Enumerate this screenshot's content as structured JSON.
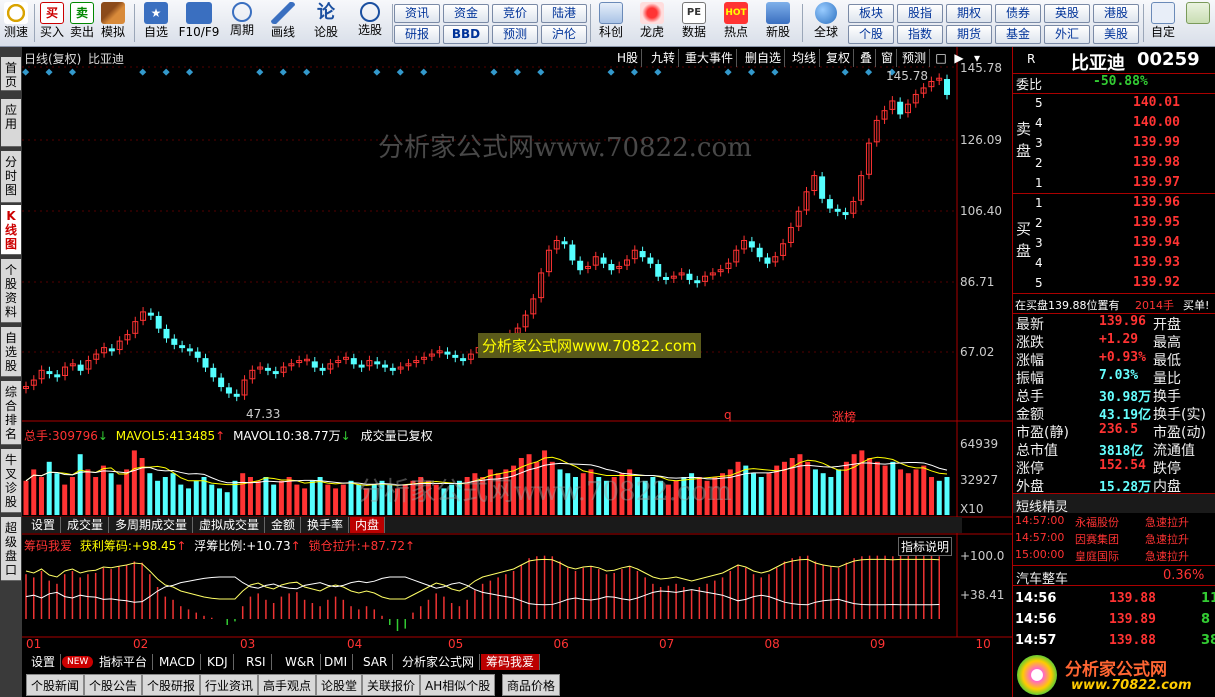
{
  "toolbar": {
    "buttons": [
      {
        "label": "测速",
        "icon": "clock-icon"
      },
      {
        "label": "买入",
        "icon": "buy-icon"
      },
      {
        "label": "卖出",
        "icon": "sell-icon"
      },
      {
        "label": "模拟",
        "icon": "hammer-icon"
      },
      {
        "label": "自选",
        "icon": "star-icon"
      },
      {
        "label": "F10/F9",
        "icon": "f10-icon"
      },
      {
        "label": "周期",
        "icon": "period-icon"
      },
      {
        "label": "画线",
        "icon": "pen-icon"
      },
      {
        "label": "论股",
        "icon": "forum-icon"
      },
      {
        "label": "选股",
        "icon": "select-stock-icon"
      },
      {
        "label": "科创",
        "icon": "kechuang-icon"
      },
      {
        "label": "龙虎",
        "icon": "dragon-tiger-icon"
      },
      {
        "label": "数据",
        "icon": "pe-icon"
      },
      {
        "label": "热点",
        "icon": "hot-icon"
      },
      {
        "label": "新股",
        "icon": "ipo-icon"
      },
      {
        "label": "全球",
        "icon": "globe-icon"
      },
      {
        "label": "自定",
        "icon": "custom-icon"
      }
    ],
    "pills": [
      "资讯",
      "资金",
      "竞价",
      "陆港",
      "研报",
      "BBD",
      "预测",
      "沪伦",
      "板块",
      "股指",
      "期权",
      "债券",
      "英股",
      "港股",
      "个股",
      "指数",
      "期货",
      "基金",
      "外汇",
      "美股"
    ],
    "f10_icon_text": "PE",
    "hot_icon_text": "HOT"
  },
  "left_tabs": [
    "首页",
    "应用",
    "分时图",
    "K线图",
    "个股资料",
    "自选股",
    "综合排名",
    "牛叉诊股",
    "超级盘口"
  ],
  "chart": {
    "title": "日线(复权)",
    "stock_name": "比亚迪",
    "top_menu": [
      "H股",
      "九转",
      "重大事件",
      "删自选",
      "均线",
      "复权",
      "叠",
      "窗",
      "预测"
    ],
    "price_axis": [
      "145.78",
      "126.09",
      "106.40",
      "86.71",
      "67.02"
    ],
    "high_label": "145.78",
    "low_label": "47.33",
    "q_mark": "q",
    "zhang_mark": "涨榜",
    "watermark1": "分析家公式网www.70822.com",
    "watermark2": "分析家公式网www.70822.com",
    "watermark3": "分析家公式网www.70822.com",
    "vol_header": {
      "label": "总手:",
      "val": "309796",
      "arrow": "↓",
      "ma5_label": "MAVOL5:",
      "ma5": "413485",
      "ma5_arrow": "↑",
      "ma10_label": "MAVOL10:",
      "ma10": "38.77万",
      "ma10_arrow": "↓",
      "note": "成交量已复权"
    },
    "vol_axis": [
      "64939",
      "32927",
      "X10"
    ],
    "mid_tabs": [
      "设置",
      "成交量",
      "多周期成交量",
      "虚拟成交量",
      "金额",
      "换手率",
      "内盘"
    ],
    "ind_header": {
      "name": "筹码我爱",
      "a_label": "获利筹码:",
      "a": "+98.45",
      "a_arrow": "↑",
      "b_label": "浮筹比例:",
      "b": "+10.73",
      "b_arrow": "↑",
      "c_label": "锁仓拉升:",
      "c": "+87.72",
      "c_arrow": "↑",
      "btn": "指标说明"
    },
    "ind_axis": [
      "+100.0",
      "+38.41"
    ],
    "months": [
      "01",
      "02",
      "03",
      "04",
      "05",
      "06",
      "07",
      "08",
      "09",
      "10"
    ],
    "candles": [
      50,
      52,
      55,
      54,
      53,
      56,
      57,
      55,
      58,
      60,
      62,
      61,
      64,
      66,
      70,
      73,
      72,
      68,
      65,
      63,
      62,
      61,
      59,
      56,
      53,
      50,
      48,
      47,
      52,
      55,
      56,
      55,
      54,
      56,
      57,
      58,
      58,
      56,
      55,
      57,
      58,
      59,
      57,
      56,
      58,
      57,
      56,
      55,
      56,
      57,
      58,
      59,
      60,
      61,
      60,
      59,
      58,
      60,
      62,
      63,
      64,
      65,
      66,
      68,
      72,
      77,
      85,
      92,
      95,
      94,
      89,
      86,
      87,
      90,
      88,
      86,
      87,
      89,
      92,
      90,
      88,
      84,
      83,
      84,
      85,
      83,
      82,
      84,
      85,
      86,
      88,
      92,
      95,
      93,
      90,
      88,
      90,
      94,
      99,
      104,
      110,
      115,
      108,
      105,
      104,
      103,
      107,
      115,
      125,
      132,
      135,
      138,
      134,
      137,
      140,
      142,
      144,
      145,
      140
    ],
    "vol_bars": [
      0.45,
      0.6,
      0.5,
      0.7,
      0.55,
      0.4,
      0.5,
      0.8,
      0.6,
      0.5,
      0.65,
      0.55,
      0.4,
      0.6,
      0.85,
      0.75,
      0.55,
      0.45,
      0.5,
      0.55,
      0.4,
      0.35,
      0.45,
      0.5,
      0.4,
      0.35,
      0.3,
      0.45,
      0.55,
      0.5,
      0.45,
      0.5,
      0.4,
      0.45,
      0.5,
      0.4,
      0.35,
      0.45,
      0.5,
      0.4,
      0.35,
      0.4,
      0.45,
      0.4,
      0.35,
      0.4,
      0.45,
      0.4,
      0.35,
      0.4,
      0.45,
      0.5,
      0.45,
      0.4,
      0.35,
      0.4,
      0.45,
      0.5,
      0.55,
      0.5,
      0.6,
      0.55,
      0.6,
      0.65,
      0.75,
      0.8,
      0.7,
      0.85,
      0.7,
      0.6,
      0.55,
      0.5,
      0.55,
      0.6,
      0.5,
      0.45,
      0.5,
      0.55,
      0.6,
      0.5,
      0.45,
      0.5,
      0.45,
      0.4,
      0.45,
      0.5,
      0.55,
      0.5,
      0.45,
      0.5,
      0.55,
      0.6,
      0.7,
      0.65,
      0.55,
      0.5,
      0.55,
      0.65,
      0.7,
      0.75,
      0.8,
      0.7,
      0.6,
      0.55,
      0.5,
      0.6,
      0.7,
      0.8,
      0.85,
      0.75,
      0.7,
      0.65,
      0.7,
      0.6,
      0.55,
      0.6,
      0.65,
      0.5,
      0.45,
      0.5
    ],
    "ind_bars": [
      0.7,
      0.65,
      0.75,
      0.6,
      0.55,
      0.7,
      0.75,
      0.65,
      0.7,
      0.72,
      0.8,
      0.78,
      0.82,
      0.85,
      0.9,
      0.88,
      0.7,
      0.5,
      0.35,
      0.3,
      0.2,
      0.15,
      0.1,
      0.05,
      0.02,
      0.0,
      -0.05,
      -0.02,
      0.2,
      0.35,
      0.4,
      0.3,
      0.25,
      0.35,
      0.4,
      0.42,
      0.3,
      0.25,
      0.2,
      0.3,
      0.35,
      0.3,
      0.2,
      0.15,
      0.2,
      0.15,
      0.05,
      -0.05,
      -0.1,
      -0.08,
      0.1,
      0.2,
      0.3,
      0.4,
      0.35,
      0.25,
      0.2,
      0.3,
      0.45,
      0.55,
      0.6,
      0.65,
      0.7,
      0.75,
      0.85,
      0.95,
      0.98,
      0.99,
      0.98,
      0.9,
      0.8,
      0.75,
      0.8,
      0.82,
      0.78,
      0.7,
      0.72,
      0.78,
      0.82,
      0.75,
      0.65,
      0.55,
      0.5,
      0.52,
      0.55,
      0.5,
      0.45,
      0.5,
      0.55,
      0.6,
      0.65,
      0.75,
      0.85,
      0.8,
      0.7,
      0.65,
      0.7,
      0.8,
      0.9,
      0.95,
      0.98,
      0.99,
      0.9,
      0.85,
      0.82,
      0.8,
      0.88,
      0.95,
      0.98,
      0.99,
      0.99,
      0.99,
      0.98,
      0.99,
      0.99,
      0.99,
      0.99,
      0.99,
      0.98
    ]
  },
  "bottom_tabs": [
    "设置",
    "NEW",
    "指标平台",
    "MACD",
    "KDJ",
    "RSI",
    "W&R",
    "DMI",
    "SAR",
    "分析家公式网",
    "筹码我爱"
  ],
  "bottom_tabs2": [
    "个股新闻",
    "个股公告",
    "个股研报",
    "行业资讯",
    "高手观点",
    "论股堂",
    "关联报价",
    "AH相似个股",
    "商品价格"
  ],
  "right": {
    "r_label": "R",
    "name": "比亚迪",
    "code": "00259",
    "weibi_label": "委比",
    "weibi": "-50.88%",
    "sell_label": "卖盘",
    "buy_label": "买盘",
    "asks": [
      {
        "n": "5",
        "p": "140.01"
      },
      {
        "n": "4",
        "p": "140.00"
      },
      {
        "n": "3",
        "p": "139.99"
      },
      {
        "n": "2",
        "p": "139.98"
      },
      {
        "n": "1",
        "p": "139.97"
      }
    ],
    "bids": [
      {
        "n": "1",
        "p": "139.96"
      },
      {
        "n": "2",
        "p": "139.95"
      },
      {
        "n": "3",
        "p": "139.94"
      },
      {
        "n": "4",
        "p": "139.93"
      },
      {
        "n": "5",
        "p": "139.92"
      }
    ],
    "notice": "在买盘139.88位置有",
    "notice_num": "2014手",
    "notice_end": "买单!",
    "stats": [
      {
        "l": "最新",
        "v": "139.96",
        "r": "开盘"
      },
      {
        "l": "涨跌",
        "v": "+1.29",
        "r": "最高"
      },
      {
        "l": "涨幅",
        "v": "+0.93%",
        "r": "最低"
      },
      {
        "l": "振幅",
        "v": "7.03%",
        "r": "量比"
      },
      {
        "l": "总手",
        "v": "30.98万",
        "r": "换手"
      },
      {
        "l": "金额",
        "v": "43.19亿",
        "r": "换手(实)"
      },
      {
        "l": "市盈(静)",
        "v": "236.5",
        "r": "市盈(动)"
      },
      {
        "l": "总市值",
        "v": "3818亿",
        "r": "流通值"
      },
      {
        "l": "涨停",
        "v": "152.54",
        "r": "跌停"
      },
      {
        "l": "外盘",
        "v": "15.28万",
        "r": "内盘"
      }
    ],
    "short_title": "短线精灵",
    "short": [
      {
        "t": "14:57:00",
        "s": "永福股份",
        "e": "急速拉升"
      },
      {
        "t": "14:57:00",
        "s": "因赛集团",
        "e": "急速拉升"
      },
      {
        "t": "15:00:00",
        "s": "皇庭国际",
        "e": "急速拉升"
      }
    ],
    "sector": "汽车整车",
    "sector_pct": "0.36%",
    "ticks": [
      {
        "t": "14:56",
        "p": "139.88",
        "v": "11"
      },
      {
        "t": "14:56",
        "p": "139.89",
        "v": "8"
      },
      {
        "t": "14:57",
        "p": "139.88",
        "v": "38"
      }
    ],
    "logo_text": "分析家公式网",
    "logo_url": "www.70822.com"
  }
}
